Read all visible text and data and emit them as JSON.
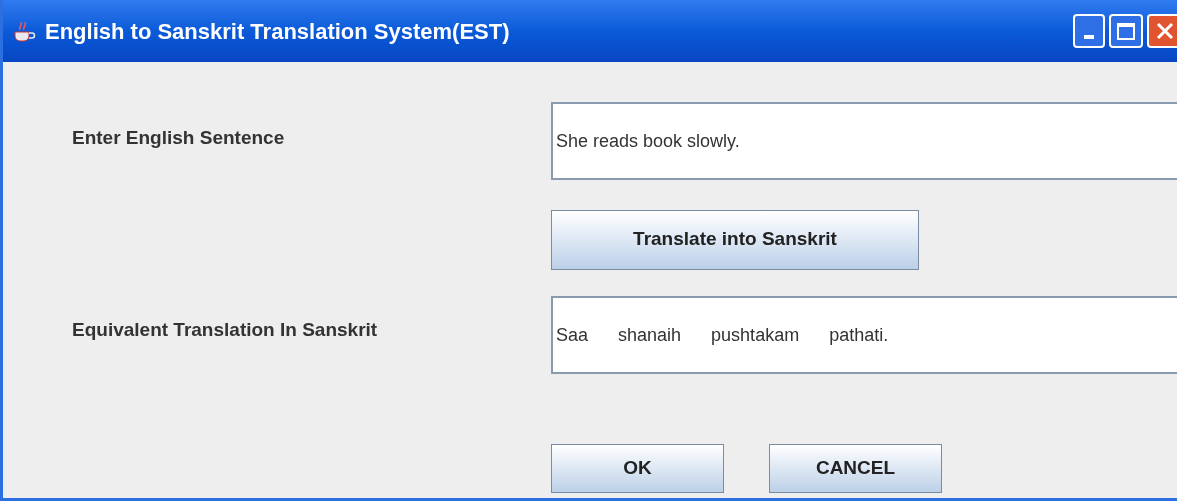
{
  "window": {
    "title": "English to Sanskrit Translation System(EST)"
  },
  "form": [
    {
      "label": "Enter English Sentence",
      "value": "She reads book slowly."
    },
    {
      "label": "Equivalent Translation In Sanskrit",
      "value": "Saa      shanaih      pushtakam      pathati."
    }
  ],
  "translate_button": "Translate into Sanskrit",
  "buttons": [
    "OK",
    "CANCEL"
  ]
}
